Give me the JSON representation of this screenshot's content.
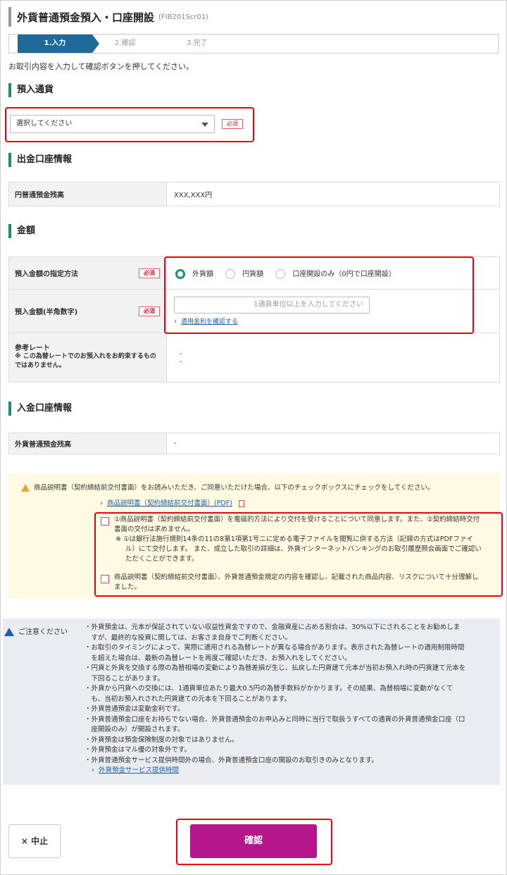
{
  "header": {
    "title": "外貨普通預金預入・口座開設",
    "screen_code": "(FIB201Scr01)"
  },
  "steps": [
    "1.入力",
    "2.確認",
    "3.完了"
  ],
  "instruction": "お取引内容を入力して確認ボタンを押してください。",
  "currency_section": {
    "title": "預入通貨",
    "select_value": "選択してください",
    "required": "必須"
  },
  "withdraw_section": {
    "title": "出金口座情報",
    "balance_label": "円普通預金残高",
    "balance_value": "XXX,XXX円"
  },
  "amount_section": {
    "title": "金額",
    "method_label": "預入金額の指定方法",
    "method_required": "必須",
    "options": [
      "外貨額",
      "円貨額",
      "口座開設のみ（0円で口座開設）"
    ],
    "selected_option": "外貨額",
    "amount_label": "預入金額(半角数字)",
    "amount_required": "必須",
    "amount_placeholder": "1通貨単位以上を入力してください",
    "rate_link": "適用金利を確認する",
    "ref_rate_label": "参考レート",
    "ref_rate_note": "※ この為替レートでのお預入れをお約束するものではありません。",
    "ref_rate_value1": "-",
    "ref_rate_value2": "-"
  },
  "deposit_section": {
    "title": "入金口座情報",
    "balance_label": "外貨普通預金残高",
    "balance_value": "-"
  },
  "consent": {
    "intro": "商品説明書（契約締結前交付書面）をお読みいただき、ご同意いただけた場合、以下のチェックボックスにチェックをしてください。",
    "pdf_link": "商品説明書（契約締結前交付書面）(PDF)",
    "check1_line1": "①商品説明書（契約締結前交付書面）を電磁的方法により交付を受けることについて同意します。また、②契約締結時交付",
    "check1_line2": "書面の交付は求めません。",
    "check1_note1": "※ ①は銀行法施行規則14条の11の8第1項第1号ニに定める電子ファイルを閲覧に供する方法（記録の方式はPDFファイ",
    "check1_note2": "ル）にて交付します。 また、成立した取引の詳細は、外貨インターネットバンキングのお取引履歴照会画面でご確認い",
    "check1_note3": "ただくことができます。",
    "check2_line1": "商品説明書（契約締結前交付書面）、外貨普通預金規定の内容を確認し、記載された商品内容、リスクについて十分理解し",
    "check2_line2": "ました。"
  },
  "notes": {
    "title": "ご注意ください",
    "items": [
      "・外貨預金は、元本が保証されていない収益性資金ですので、金融資産に占める割合は、30%以下にされることをお勧めしま",
      "　すが、最終的な投資に関しては、お客さま自身でご判断ください。",
      "・お取引のタイミングによって、実際に適用される為替レートが異なる場合があります。表示された為替レートの適用制限時間",
      "　を超えた場合は、最新の為替レートを再度ご確認いただき、お預入れをしてください。",
      "・円貨と外貨を交換する際の為替相場の変動により為替差損が生じ、払戻した円貨建て元本が当初お預入れ時の円貨建て元本を",
      "　下回ることがあります。",
      "・外貨から円貨への交換には、1通貨単位あたり最大0.5円の為替手数料がかかります。その結果、為替相場に変動がなくて",
      "　も、当初お預入れされた円貨建ての元本を下回ることがあります。",
      "・外貨普通預金は変動金利です。",
      "・外貨普通預金口座をお持ちでない場合、外貨普通預金のお申込みと同時に当行で取扱うすべての通貨の外貨普通預金口座（口",
      "　座開設のみ）が開設されます。",
      "・外貨預金は預金保険制度の対象ではありません。",
      "・外貨預金はマル優の対象外です。",
      "・外貨普通預金サービス提供時間外の場合、外貨普通預金口座の開設のお取引きのみとなります。"
    ],
    "link": "外貨預金サービス提供時間"
  },
  "buttons": {
    "cancel": "中止",
    "cancel_icon": "×",
    "confirm": "確認"
  },
  "colors": {
    "accent": "#1a8f6a",
    "step_active": "#1f6a98",
    "confirm": "#b5178a",
    "highlight": "#e60012"
  }
}
